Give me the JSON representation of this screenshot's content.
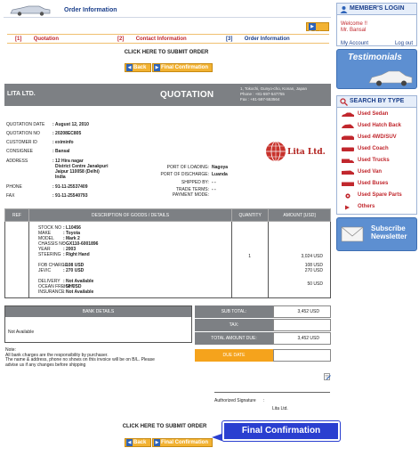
{
  "header": {
    "title": "Order Information"
  },
  "print_label": "Print",
  "steps": [
    {
      "num": "[1]",
      "label": "Quotation"
    },
    {
      "num": "[2]",
      "label": "Contact Information"
    },
    {
      "num": "[3]",
      "label": "Order Information"
    }
  ],
  "submit_text": "CLICK HERE TO SUBMIT ORDER",
  "back_label": "Back",
  "final_label": "Final Confirmation",
  "quotation": {
    "company": "LITA LTD.",
    "title": "QUOTATION",
    "address": [
      "1, Tokochi, Gunyo-cho, Konan, Japan",
      "Phone : +81-597-547755",
      "Fax : +81-597-553564"
    ],
    "logo_text": "Lita Ltd."
  },
  "info": [
    {
      "label": "QUOTATION DATE",
      "value": ": August 12, 2010"
    },
    {
      "label": "QUOTATION NO",
      "value": ": 20208EC805"
    },
    {
      "label": "CUSTOMER ID",
      "value": ": eximinfo"
    },
    {
      "label": "CONSIGNEE",
      "value": ": Bansal"
    },
    {
      "label": "ADDRESS",
      "value": ": 12 Hira nagar"
    },
    {
      "label": "",
      "value": "District Centre Janakpuri"
    },
    {
      "label": "",
      "value": "Jaipur 110058 (Delhi)"
    },
    {
      "label": "",
      "value": "India"
    },
    {
      "label": "PHONE",
      "value": ": 91-11-25537409"
    },
    {
      "label": "FAX",
      "value": ": 91-11-25540793"
    }
  ],
  "shipping": [
    {
      "label": "PORT OF LOADING:",
      "value": "Nagoya"
    },
    {
      "label": "PORT OF DISCHARGE:",
      "value": "Luanda"
    },
    {
      "label": "SHIPPED BY:",
      "value": "- -"
    },
    {
      "label": "TRADE TERMS:",
      "value": "- -"
    },
    {
      "label": "PAYMENT MODE:",
      "value": ""
    }
  ],
  "table": {
    "headers": [
      "REF",
      "DESCRIPTION OF GOODS / DETAILS",
      "QUANTITY",
      "AMOUNT [USD]"
    ],
    "specs": [
      {
        "label": "STOCK NO",
        "value": ": L10456"
      },
      {
        "label": "MAKE",
        "value": ": Toyota"
      },
      {
        "label": "MODEL",
        "value": ": Mark 2"
      },
      {
        "label": "CHASSIS NO",
        "value": ": GX110-6001896"
      },
      {
        "label": "YEAR",
        "value": ": 2003"
      },
      {
        "label": "STEERING",
        "value": ": Right Hand"
      },
      {
        "label": "FOB CHARGE",
        "value": ": 108 USD"
      },
      {
        "label": "JEVIC",
        "value": ": 270 USD"
      },
      {
        "label": "DELIVERY",
        "value": ": Not Available"
      },
      {
        "label": "OCEAN FREIGHT",
        "value": ": 50 USD"
      },
      {
        "label": "INSURANCE",
        "value": ": Not Available"
      }
    ],
    "quantity": "1",
    "amounts": [
      "3,024 USD",
      "108 USD",
      "270 USD",
      "50 USD"
    ]
  },
  "bank": {
    "header": "BANK DETAILS",
    "value": "Not Available"
  },
  "totals": [
    {
      "label": "SUB TOTAL:",
      "value": "3,452 USD"
    },
    {
      "label": "TAX:",
      "value": ""
    },
    {
      "label": "TOTAL AMOUNT DUE:",
      "value": "3,452 USD"
    },
    {
      "label": "DUE DATE",
      "value": ""
    }
  ],
  "note": {
    "title": "Note:",
    "lines": [
      "All bank charges are the responsibility by purchaser.",
      "The name & address, phone no shows on this invoice will be on B/L. Please",
      "advise us if any changes before shipping"
    ]
  },
  "signature": {
    "label": "Authorized Signature",
    "sep": ":",
    "company": "Lita Ltd."
  },
  "callout": "Final Confirmation",
  "sidebar": {
    "login": {
      "title": "MEMBER'S LOGIN",
      "welcome": "Welcome !!",
      "name": "Mr. Bansal",
      "account": "My Account",
      "logout": "Log out"
    },
    "testimonials": "Testimonials",
    "search_title": "SEARCH BY TYPE",
    "categories": [
      "Used Sedan",
      "Used Hatch Back",
      "Used 4WD/SUV",
      "Used Coach",
      "Used Trucks",
      "Used Van",
      "Used Buses",
      "Used Spare Parts",
      "Others"
    ],
    "newsletter": [
      "Subscribe",
      "Newsletter"
    ]
  },
  "colors": {
    "accent_blue": "#1b3f8b",
    "accent_red": "#c1272d",
    "button_orange": "#f2b232",
    "header_gray": "#7d8084"
  }
}
